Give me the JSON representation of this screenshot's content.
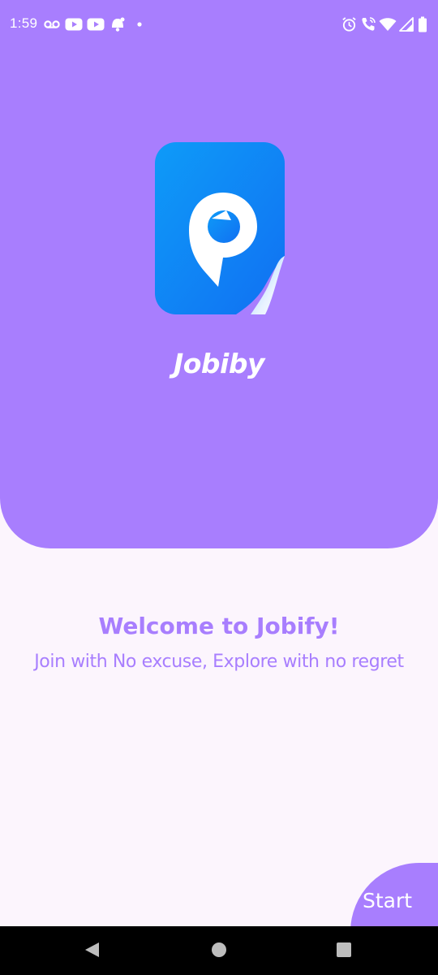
{
  "status_bar": {
    "time": "1:59",
    "left_icons": [
      "voicemail-icon",
      "youtube-icon",
      "youtube-icon",
      "notification-bell-icon",
      "dot-icon"
    ],
    "right_icons": [
      "alarm-icon",
      "wifi-calling-icon",
      "wifi-icon",
      "cell-signal-icon",
      "battery-icon"
    ]
  },
  "app": {
    "name": "Jobiby",
    "logo_icon": "jobify-logo-icon"
  },
  "welcome": {
    "title": "Welcome to Jobify!",
    "subtitle": "Join with No excuse, Explore with no regret"
  },
  "start_button": {
    "label": "Start"
  },
  "nav_bar": {
    "buttons": [
      "back-icon",
      "home-icon",
      "recents-icon"
    ]
  },
  "colors": {
    "accent": "#A87EFE",
    "background": "#FCF5FD",
    "logo_blue": "#1283F7"
  }
}
